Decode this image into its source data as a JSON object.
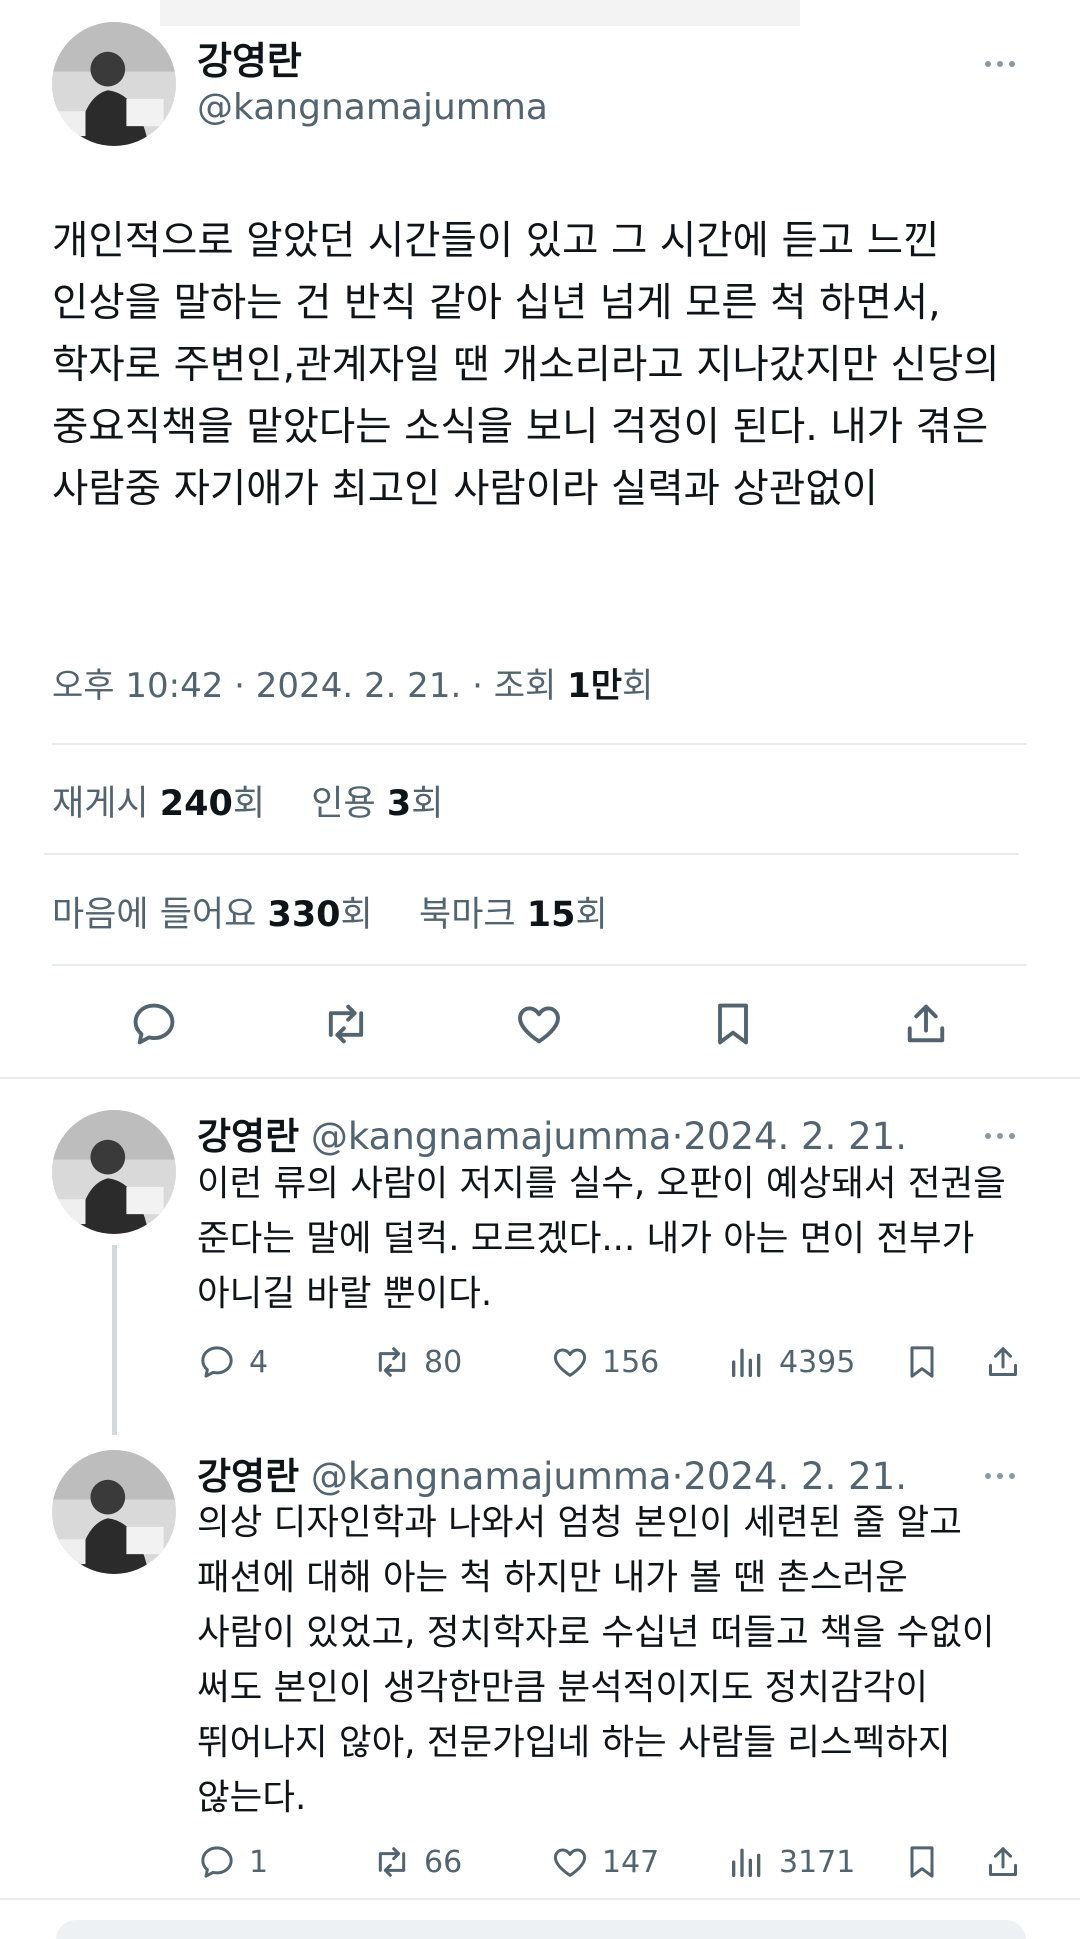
{
  "tweet": {
    "author_name": "강영란",
    "author_handle": "@kangnamajumma",
    "text": "개인적으로 알았던 시간들이 있고 그 시간에 듣고 느낀 인상을 말하는 건 반칙 같아 십년 넘게 모른 척 하면서, 학자로 주변인,관계자일 땐  개소리라고 지나갔지만 신당의 중요직책을 맡았다는 소식을 보니  걱정이 된다. 내가 겪은 사람중 자기애가 최고인 사람이라 실력과 상관없이",
    "time": "오후 10:42",
    "date": "2024. 2. 21.",
    "views_label": "조회",
    "views": "1만",
    "views_unit": "회",
    "separator": "·",
    "stats": {
      "retweets_label": "재게시",
      "retweets": "240",
      "quotes_label": "인용",
      "quotes": "3",
      "likes_label": "마음에 들어요",
      "likes": "330",
      "bookmarks_label": "북마크",
      "bookmarks": "15",
      "unit": "회"
    },
    "icons": [
      "reply-icon",
      "retweet-icon",
      "like-icon",
      "bookmark-icon",
      "share-icon"
    ]
  },
  "replies": [
    {
      "author_name": "강영란",
      "author_handle": "@kangnamajumma",
      "separator": "·",
      "date": "2024. 2. 21.",
      "text": "이런 류의 사람이 저지를 실수, 오판이 예상돼서 전권을 준다는 말에 덜컥. 모르겠다... 내가 아는 면이 전부가 아니길 바랄 뿐이다.",
      "replies": "4",
      "retweets": "80",
      "likes": "156",
      "views": "4395"
    },
    {
      "author_name": "강영란",
      "author_handle": "@kangnamajumma",
      "separator": "·",
      "date": "2024. 2. 21.",
      "text": "의상 디자인학과 나와서 엄청 본인이 세련된 줄 알고 패션에 대해 아는 척 하지만  내가 볼 땐 촌스러운 사람이 있었고,  정치학자로 수십년 떠들고 책을 수없이 써도 본인이 생각한만큼 분석적이지도 정치감각이 뛰어나지 않아, 전문가입네 하는 사람들 리스펙하지 않는다.",
      "replies": "1",
      "retweets": "66",
      "likes": "147",
      "views": "3171"
    }
  ],
  "colors": {
    "text": "#0f1419",
    "secondary": "#536471",
    "divider": "#e7ebee",
    "icon": "#536471"
  }
}
